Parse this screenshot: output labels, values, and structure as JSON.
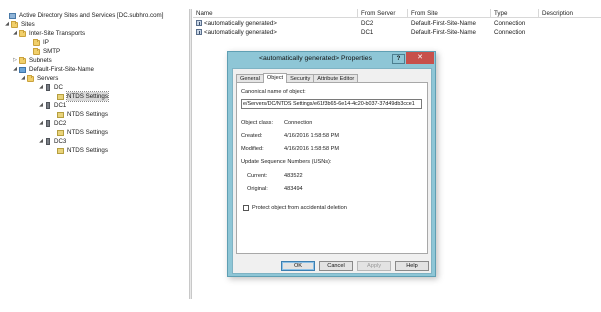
{
  "tree": {
    "nodes": [
      {
        "label": "Active Directory Sites and Services [DC.subhro.com]",
        "icon": "ad-sites-icon",
        "expander": ""
      },
      {
        "label": "Sites",
        "icon": "folder-icon",
        "expander": "◢"
      },
      {
        "label": "Inter-Site Transports",
        "icon": "folder-icon",
        "expander": "◢"
      },
      {
        "label": "IP",
        "icon": "folder-icon",
        "expander": ""
      },
      {
        "label": "SMTP",
        "icon": "folder-icon",
        "expander": ""
      },
      {
        "label": "Subnets",
        "icon": "folder-icon",
        "expander": "▷"
      },
      {
        "label": "Default-First-Site-Name",
        "icon": "site-icon",
        "expander": "◢"
      },
      {
        "label": "Servers",
        "icon": "folder-icon",
        "expander": "◢"
      },
      {
        "label": "DC",
        "icon": "server-icon",
        "expander": "◢"
      },
      {
        "label": "NTDS Settings",
        "icon": "ntds-settings-icon",
        "expander": ""
      },
      {
        "label": "DC1",
        "icon": "server-icon",
        "expander": "◢"
      },
      {
        "label": "NTDS Settings",
        "icon": "ntds-settings-icon",
        "expander": ""
      },
      {
        "label": "DC2",
        "icon": "server-icon",
        "expander": "◢"
      },
      {
        "label": "NTDS Settings",
        "icon": "ntds-settings-icon",
        "expander": ""
      },
      {
        "label": "DC3",
        "icon": "server-icon",
        "expander": "◢"
      },
      {
        "label": "NTDS Settings",
        "icon": "ntds-settings-icon",
        "expander": ""
      }
    ]
  },
  "list": {
    "columns": [
      "Name",
      "From Server",
      "From Site",
      "Type",
      "Description"
    ],
    "rows": [
      {
        "name": "<automatically generated>",
        "from_server": "DC2",
        "from_site": "Default-First-Site-Name",
        "type": "Connection",
        "description": ""
      },
      {
        "name": "<automatically generated>",
        "from_server": "DC1",
        "from_site": "Default-First-Site-Name",
        "type": "Connection",
        "description": ""
      }
    ]
  },
  "dialog": {
    "title": "<automatically generated> Properties",
    "help_label": "?",
    "close_label": "✕",
    "tabs": [
      "General",
      "Object",
      "Security",
      "Attribute Editor"
    ],
    "active_tab": "Object",
    "canonical_label": "Canonical name of object:",
    "canonical_value": "e/Servers/DC/NTDS Settings/e61f3b65-6e14-4c20-b037-37d49db3cce1",
    "object_class_label": "Object class:",
    "object_class_value": "Connection",
    "created_label": "Created:",
    "created_value": "4/16/2016 1:58:58 PM",
    "modified_label": "Modified:",
    "modified_value": "4/16/2016 1:58:58 PM",
    "usn_label": "Update Sequence Numbers (USNs):",
    "current_label": "Current:",
    "current_value": "483522",
    "original_label": "Original:",
    "original_value": "483494",
    "protect_label": "Protect object from accidental deletion",
    "protect_checked": false,
    "buttons": {
      "ok": "OK",
      "cancel": "Cancel",
      "apply": "Apply",
      "help": "Help"
    }
  },
  "colors": {
    "dialog_frame": "#8ec6d6",
    "close_button": "#c7504b",
    "selected_row": "#d9d9d9"
  }
}
